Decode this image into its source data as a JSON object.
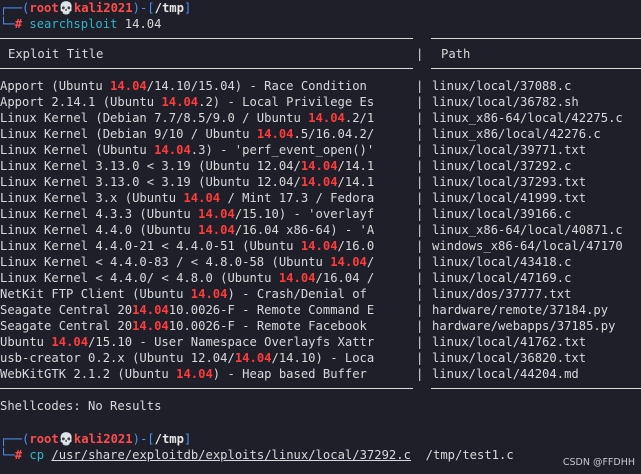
{
  "prompt1": {
    "user": "root",
    "skull": "💀",
    "host": "kali2021",
    "cwd": "/tmp"
  },
  "command1": {
    "name": "searchsploit",
    "arg": "14.04"
  },
  "table": {
    "col1_header": "Exploit Title",
    "col2_header": "Path",
    "rows": [
      {
        "pre": "Apport (Ubuntu ",
        "hl": "14.04",
        "post": "/14.10/15.04) - Race Condition",
        "path": "linux/local/37088.c"
      },
      {
        "pre": "Apport 2.14.1 (Ubuntu ",
        "hl": "14.04",
        "post": ".2) - Local Privilege Es",
        "path": "linux/local/36782.sh"
      },
      {
        "pre": "Linux Kernel (Debian 7.7/8.5/9.0 / Ubuntu ",
        "hl": "14.04",
        "post": ".2/1",
        "path": "linux_x86-64/local/42275.c"
      },
      {
        "pre": "Linux Kernel (Debian 9/10 / Ubuntu ",
        "hl": "14.04",
        "post": ".5/16.04.2/",
        "path": "linux_x86/local/42276.c"
      },
      {
        "pre": "Linux Kernel (Ubuntu ",
        "hl": "14.04",
        "post": ".3) - 'perf_event_open()'",
        "path": "linux/local/39771.txt"
      },
      {
        "pre": "Linux Kernel 3.13.0 < 3.19 (Ubuntu 12.04/",
        "hl": "14.04",
        "post": "/14.1",
        "path": "linux/local/37292.c"
      },
      {
        "pre": "Linux Kernel 3.13.0 < 3.19 (Ubuntu 12.04/",
        "hl": "14.04",
        "post": "/14.1",
        "path": "linux/local/37293.txt"
      },
      {
        "pre": "Linux Kernel 3.x (Ubuntu ",
        "hl": "14.04",
        "post": " / Mint 17.3 / Fedora",
        "path": "linux/local/41999.txt"
      },
      {
        "pre": "Linux Kernel 4.3.3 (Ubuntu ",
        "hl": "14.04",
        "post": "/15.10) - 'overlayf",
        "path": "linux/local/39166.c"
      },
      {
        "pre": "Linux Kernel 4.4.0 (Ubuntu ",
        "hl": "14.04",
        "post": "/16.04 x86-64) - 'A",
        "path": "linux_x86-64/local/40871.c"
      },
      {
        "pre": "Linux Kernel 4.4.0-21 < 4.4.0-51 (Ubuntu ",
        "hl": "14.04",
        "post": "/16.0",
        "path": "windows_x86-64/local/47170"
      },
      {
        "pre": "Linux Kernel < 4.4.0-83 / < 4.8.0-58 (Ubuntu ",
        "hl": "14.04",
        "post": "/",
        "path": "linux/local/43418.c"
      },
      {
        "pre": "Linux Kernel < 4.4.0/ < 4.8.0 (Ubuntu ",
        "hl": "14.04",
        "post": "/16.04 /",
        "path": "linux/local/47169.c"
      },
      {
        "pre": "NetKit FTP Client (Ubuntu ",
        "hl": "14.04",
        "post": ") - Crash/Denial of",
        "path": "linux/dos/37777.txt"
      },
      {
        "pre": "Seagate Central 20",
        "hl": "14.04",
        "post": "10.0026-F - Remote Command E",
        "path": "hardware/remote/37184.py"
      },
      {
        "pre": "Seagate Central 20",
        "hl": "14.04",
        "post": "10.0026-F - Remote Facebook",
        "path": "hardware/webapps/37185.py"
      },
      {
        "pre": "Ubuntu ",
        "hl": "14.04",
        "post": "/15.10 - User Namespace Overlayfs Xattr",
        "path": "linux/local/41762.txt"
      },
      {
        "pre": "usb-creator 0.2.x (Ubuntu 12.04/",
        "hl": "14.04",
        "post": "/14.10) - Loca",
        "path": "linux/local/36820.txt"
      },
      {
        "pre": "WebKitGTK 2.1.2 (Ubuntu ",
        "hl": "14.04",
        "post": ") - Heap based Buffer",
        "path": "linux/local/44204.md"
      }
    ],
    "separator": "|"
  },
  "shellcodes": "Shellcodes: No Results",
  "prompt2": {
    "user": "root",
    "skull": "💀",
    "host": "kali2021",
    "cwd": "/tmp"
  },
  "command2": {
    "name": "cp",
    "arg1": "/usr/share/exploitdb/exploits/linux/local/37292.c",
    "arg2": "/tmp/test1.c"
  },
  "watermark": "CSDN @FFDHH"
}
